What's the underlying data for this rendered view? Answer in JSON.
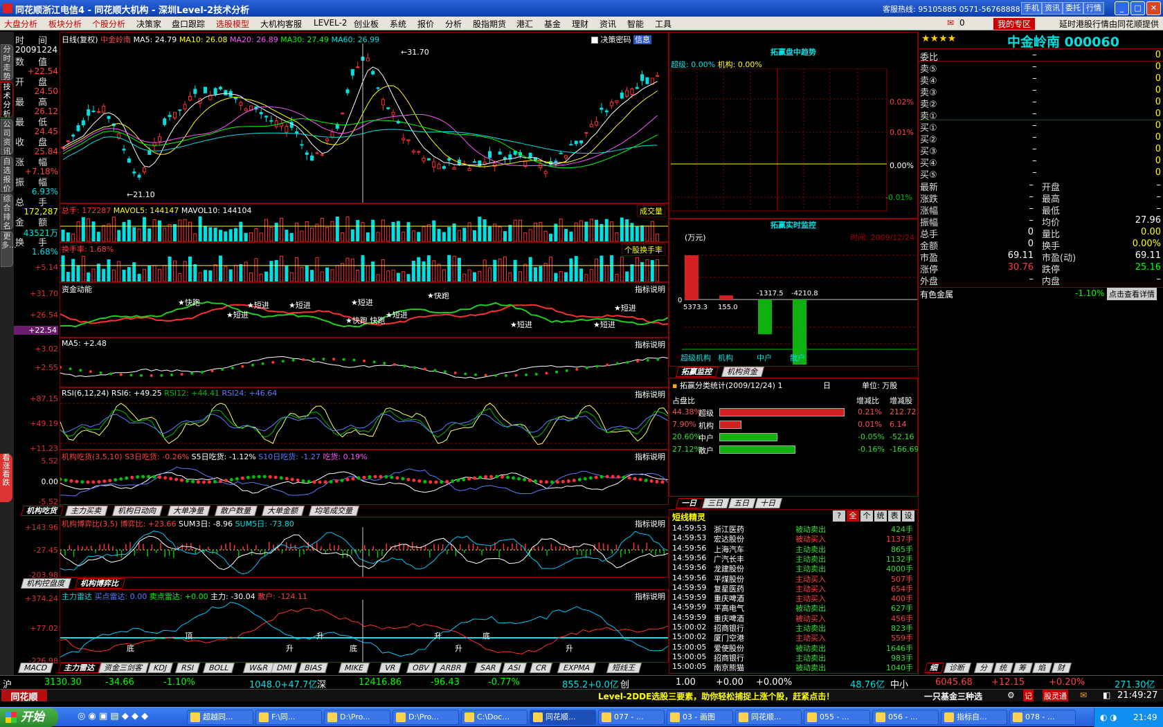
{
  "window": {
    "title": "同花顺浙江电信4 - 同花顺大机构 - 深圳Level-2技术分析",
    "hotline": "客服热线: 95105885 0571-56768888",
    "buttons": [
      "手机",
      "资讯",
      "委托",
      "行情"
    ],
    "win_controls": [
      "_",
      "□",
      "✕"
    ]
  },
  "menu": {
    "items": [
      "大盘分析",
      "板块分析",
      "个股分析",
      "决策家",
      "盘口跟踪",
      "选股模型",
      "大机构客服",
      "LEVEL-2",
      "创业板",
      "系统",
      "报价",
      "分析",
      "股指期货",
      "港汇",
      "基金",
      "理财",
      "资讯",
      "智能",
      "工具"
    ],
    "red_items": [
      "大盘分析",
      "板块分析",
      "个股分析",
      "选股模型"
    ],
    "mail_count": "0",
    "my_zone": "我的专区",
    "notice": "延时港股行情由同花顺提供"
  },
  "left_tabs": [
    "分时走势",
    "技术分析",
    "公司资讯",
    "自选报价",
    "综合排名",
    "更多..."
  ],
  "red_side_tab": "看涨看跌",
  "info_col": {
    "time_label": "时 间",
    "date": "20091224",
    "value_label": "数 值",
    "value": "+22.54",
    "open_label": "开 盘",
    "open": "24.50",
    "high_label": "最 高",
    "high": "26.12",
    "low_label": "最 低",
    "low": "24.45",
    "close_label": "收 盘",
    "close": "25.84",
    "change_label": "涨 幅",
    "change": "+7.18%",
    "amp_label": "振 幅",
    "amp": "6.93%",
    "vol_label": "总 手",
    "vol": "172,287",
    "amt_label": "金 额",
    "amt": "43521万",
    "turnover_label": "换 手",
    "turnover": "1.68%",
    "y_5": "+5.14",
    "y_3171": "+31.70",
    "y_2654": "+26.54",
    "y_2254": "+22.54",
    "y_302": "+3.02",
    "y_255": "+2.55",
    "y_8715": "+87.15",
    "y_4919": "+49.19",
    "y_1123": "+11.23",
    "y_552": "5.52",
    "y_000": "0.00",
    "y_m552": "-5.52",
    "y_14396": "+143.96",
    "y_m2745": "-27.45",
    "y_m20398": "-203.98",
    "y_37424": "+374.24",
    "y_7702": "+77.02",
    "y_m22698": "-226.98"
  },
  "kline": {
    "header_items": [
      {
        "text": "日线(复权)",
        "color": "#ffffff"
      },
      {
        "text": "中金岭南",
        "color": "#ff4040"
      },
      {
        "text": "MA5: 24.79",
        "color": "#ffffff"
      },
      {
        "text": "MA10: 26.08",
        "color": "#ffff00"
      },
      {
        "text": "MA20: 26.89",
        "color": "#ff55ff"
      },
      {
        "text": "MA30: 27.49",
        "color": "#00ff00"
      },
      {
        "text": "MA60: 26.99",
        "color": "#00e0e0"
      }
    ],
    "decision_label": "决策密码",
    "info_label": "信息",
    "high_mark": "31.70",
    "low_mark": "21.10"
  },
  "volume": {
    "header": "总手: 172287",
    "mavol5": "MAVOL5: 144147",
    "mavol10": "MAVOL10: 144104",
    "switch": "成交量",
    "turn_header": "换手率: 1.68%",
    "turn_switch": "个股换手率"
  },
  "capital": {
    "title": "资金动能",
    "explain": "指标说明",
    "labels": [
      "快跑",
      "短进",
      "短进",
      "短进",
      "短进",
      "短进",
      "快跑",
      "短进",
      "短进",
      "短进",
      "快跑 快跑",
      "短进"
    ]
  },
  "ma5_panel": {
    "header": "MA5: +2.48",
    "explain": "指标说明"
  },
  "rsi_panel": {
    "header_items": [
      {
        "text": "RSI(6,12,24) RSI6: +49.25",
        "color": "#ffffff"
      },
      {
        "text": "RSI12: +44.41",
        "color": "#00c000"
      },
      {
        "text": "RSI24: +46.64",
        "color": "#5a7cff"
      }
    ],
    "explain": "指标说明"
  },
  "inst_panel": {
    "header_items": [
      {
        "text": "机构吃货(3,5,10) S3日吃货: -0.26%",
        "color": "#ff4040"
      },
      {
        "text": "S5日吃货: -1.12%",
        "color": "#ffffff"
      },
      {
        "text": "S10日吃货: -1.27",
        "color": "#5a7cff"
      },
      {
        "text": "吃货: 0.19%",
        "color": "#ff55ff"
      }
    ],
    "explain": "指标说明"
  },
  "tabs_row1": [
    "机构吃货",
    "主力买卖",
    "机构日动向",
    "大单净量",
    "散户数量",
    "大单金额",
    "均笔成交量"
  ],
  "game_panel": {
    "header_items": [
      {
        "text": "机构博弈比(3,5) 博弈比: +23.66",
        "color": "#ff4040"
      },
      {
        "text": "SUM3日: -8.96",
        "color": "#ffffff"
      },
      {
        "text": "SUM5日: -73.80",
        "color": "#00e0e0"
      }
    ],
    "explain": "指标说明"
  },
  "tabs_row2": [
    "机构控盘度",
    "机构博弈比"
  ],
  "radar_panel": {
    "header_items": [
      {
        "text": "主力雷达",
        "color": "#00e0e0"
      },
      {
        "text": "买点雷达: 0.00",
        "color": "#5a7cff"
      },
      {
        "text": "卖点雷达: +0.00",
        "color": "#00ff00"
      },
      {
        "text": "主力: -30.04",
        "color": "#ffffff"
      },
      {
        "text": "散户: -124.11",
        "color": "#ff4040"
      }
    ],
    "explain": "指标说明",
    "marks": [
      "底",
      "顶",
      "升",
      "升",
      "底",
      "升",
      "升",
      "底",
      "升"
    ]
  },
  "bottom_tabs": [
    "MACD",
    "主力雷达",
    "资金三剑客",
    "KDJ",
    "RSI",
    "BOLL",
    "W&R",
    "DMI",
    "BIAS",
    "MIKE",
    "VR",
    "OBV",
    "ARBR",
    "SAR",
    "ASI",
    "CR",
    "EXPMA",
    "短线王"
  ],
  "trend": {
    "title": "拓赢盘中趋势",
    "super": "超级: 0.00%",
    "inst": "机构: 0.00%",
    "y": [
      "0.02%",
      "0.01%",
      "0.00%",
      "-0.01%"
    ]
  },
  "monitor": {
    "title": "拓赢实时监控",
    "unit": "(万元)",
    "time": "时间: 2009/12/24",
    "values": [
      "5373.3",
      "155.0",
      "-1317.5",
      "-4210.8"
    ],
    "xlabels": [
      "超级机构",
      "机构",
      "中户",
      "散户"
    ],
    "zero": "0"
  },
  "monitor_tabs": [
    "拓赢监控",
    "机构资金"
  ],
  "stats": {
    "title": "拓赢分类统计(2009/12/24)",
    "num": "1",
    "period": "日",
    "unit": "单位: 万股",
    "col1": "占盘比",
    "col2": "增减比",
    "col3": "增减股",
    "rows": [
      {
        "pct": "44.38%",
        "name": "超级",
        "d": "0.21%",
        "v": "212.72",
        "frac": 0.95,
        "color": "#d42020"
      },
      {
        "pct": "7.90%",
        "name": "机构",
        "d": "0.01%",
        "v": "6.14",
        "frac": 0.17,
        "color": "#d42020"
      },
      {
        "pct": "20.60%",
        "name": "中户",
        "d": "-0.05%",
        "v": "-52.16",
        "frac": 0.44,
        "color": "#10b010"
      },
      {
        "pct": "27.12%",
        "name": "散户",
        "d": "-0.16%",
        "v": "-166.69",
        "frac": 0.58,
        "color": "#10b010"
      }
    ]
  },
  "day_tabs": [
    "一日",
    "三日",
    "五日",
    "十日"
  ],
  "elves": {
    "title": "短线精灵",
    "btns": [
      "?",
      "全",
      "个",
      "统",
      "表",
      "设"
    ],
    "rows": [
      [
        "14:59:53",
        "浙江医药",
        "被动卖出",
        "424手"
      ],
      [
        "14:59:53",
        "宏达股份",
        "被动买入",
        "1137手"
      ],
      [
        "14:59:56",
        "上海汽车",
        "主动卖出",
        "865手"
      ],
      [
        "14:59:56",
        "广汽长丰",
        "主动卖出",
        "1132手"
      ],
      [
        "14:59:56",
        "龙建股份",
        "主动卖出",
        "4000手"
      ],
      [
        "14:59:56",
        "平煤股份",
        "主动买入",
        "507手"
      ],
      [
        "14:59:59",
        "复星医药",
        "主动买入",
        "654手"
      ],
      [
        "14:59:59",
        "重庆啤酒",
        "主动买入",
        "400手"
      ],
      [
        "14:59:59",
        "平高电气",
        "被动卖出",
        "627手"
      ],
      [
        "14:59:59",
        "重庆啤酒",
        "被动买入",
        "456手"
      ],
      [
        "15:00:02",
        "招商银行",
        "主动卖出",
        "823手"
      ],
      [
        "15:00:02",
        "厦门空港",
        "主动买入",
        "559手"
      ],
      [
        "15:00:05",
        "爱使股份",
        "被动卖出",
        "1646手"
      ],
      [
        "15:00:05",
        "招商银行",
        "主动卖出",
        "983手"
      ],
      [
        "15:00:05",
        "南京熊猫",
        "被动卖出",
        "1040手"
      ]
    ]
  },
  "quote": {
    "stars": "★★★★",
    "name": "中金岭南 000060",
    "rows": [
      [
        "委比",
        "–",
        "0"
      ],
      [
        "卖⑤",
        "–",
        "0"
      ],
      [
        "卖④",
        "–",
        "0"
      ],
      [
        "卖③",
        "–",
        "0"
      ],
      [
        "卖②",
        "–",
        "0"
      ],
      [
        "卖①",
        "–",
        "0"
      ],
      [
        "买①",
        "–",
        "0"
      ],
      [
        "买②",
        "–",
        "0"
      ],
      [
        "买③",
        "–",
        "0"
      ],
      [
        "买④",
        "–",
        "0"
      ],
      [
        "买⑤",
        "–",
        "0"
      ]
    ],
    "stats": [
      [
        "最新",
        "–",
        "开盘",
        "–"
      ],
      [
        "涨跌",
        "–",
        "最高",
        "–"
      ],
      [
        "涨幅",
        "–",
        "最低",
        "–"
      ],
      [
        "振幅",
        "–",
        "均价",
        "27.96"
      ],
      [
        "总手",
        "0",
        "量比",
        "0.00"
      ],
      [
        "金额",
        "0",
        "换手",
        "0.00%"
      ],
      [
        "市盈",
        "69.11",
        "市盈(动)",
        "69.11"
      ],
      [
        "涨停",
        "30.76",
        "跌停",
        "25.16"
      ],
      [
        "外盘",
        "–",
        "内盘",
        "–"
      ]
    ],
    "sector": "有色金属",
    "sector_chg": "-1.10%",
    "detail_btn": "点击查看详情",
    "tabs": [
      "细",
      "诊断",
      "分",
      "统",
      "筹",
      "焰",
      "财"
    ]
  },
  "status": {
    "sh": "沪",
    "sh_idx": "3130.30",
    "sh_chg": "-34.66",
    "sh_pct": "-1.10%",
    "sh_amt": "1048.0+47.7亿",
    "sz": "深",
    "sz_idx": "12416.86",
    "sz_chg": "-96.43",
    "sz_pct": "-0.77%",
    "sz_amt": "855.2+0.0亿",
    "cy": "创",
    "cy_idx": "1.00",
    "cy_chg": "+0.00",
    "cy_pct": "+0.00%",
    "cy_amt": "48.76亿",
    "zx": "中小",
    "zx_idx": "6045.68",
    "zx_chg": "+12.15",
    "zx_pct": "+0.20%",
    "zx_amt": "271.30亿"
  },
  "infobar": {
    "logo": "同花顺",
    "msg": "Level-2DDE选股三要素，助你轻松捕捉上涨个股，赶紧点击！",
    "right": "一只基金三种选",
    "time": "21:49:27"
  },
  "taskbar": {
    "start": "开始",
    "tasks": [
      "超越同...",
      "F:\\同...",
      "D:\\Pro...",
      "D:\\Pro...",
      "C:\\Doc...",
      "同花顺...",
      "077 - ...",
      "03 - 画图",
      "同花顺...",
      "055 - ...",
      "056 - ...",
      "指标自...",
      "078 - ..."
    ],
    "active_index": 5,
    "clock": "21:49"
  }
}
